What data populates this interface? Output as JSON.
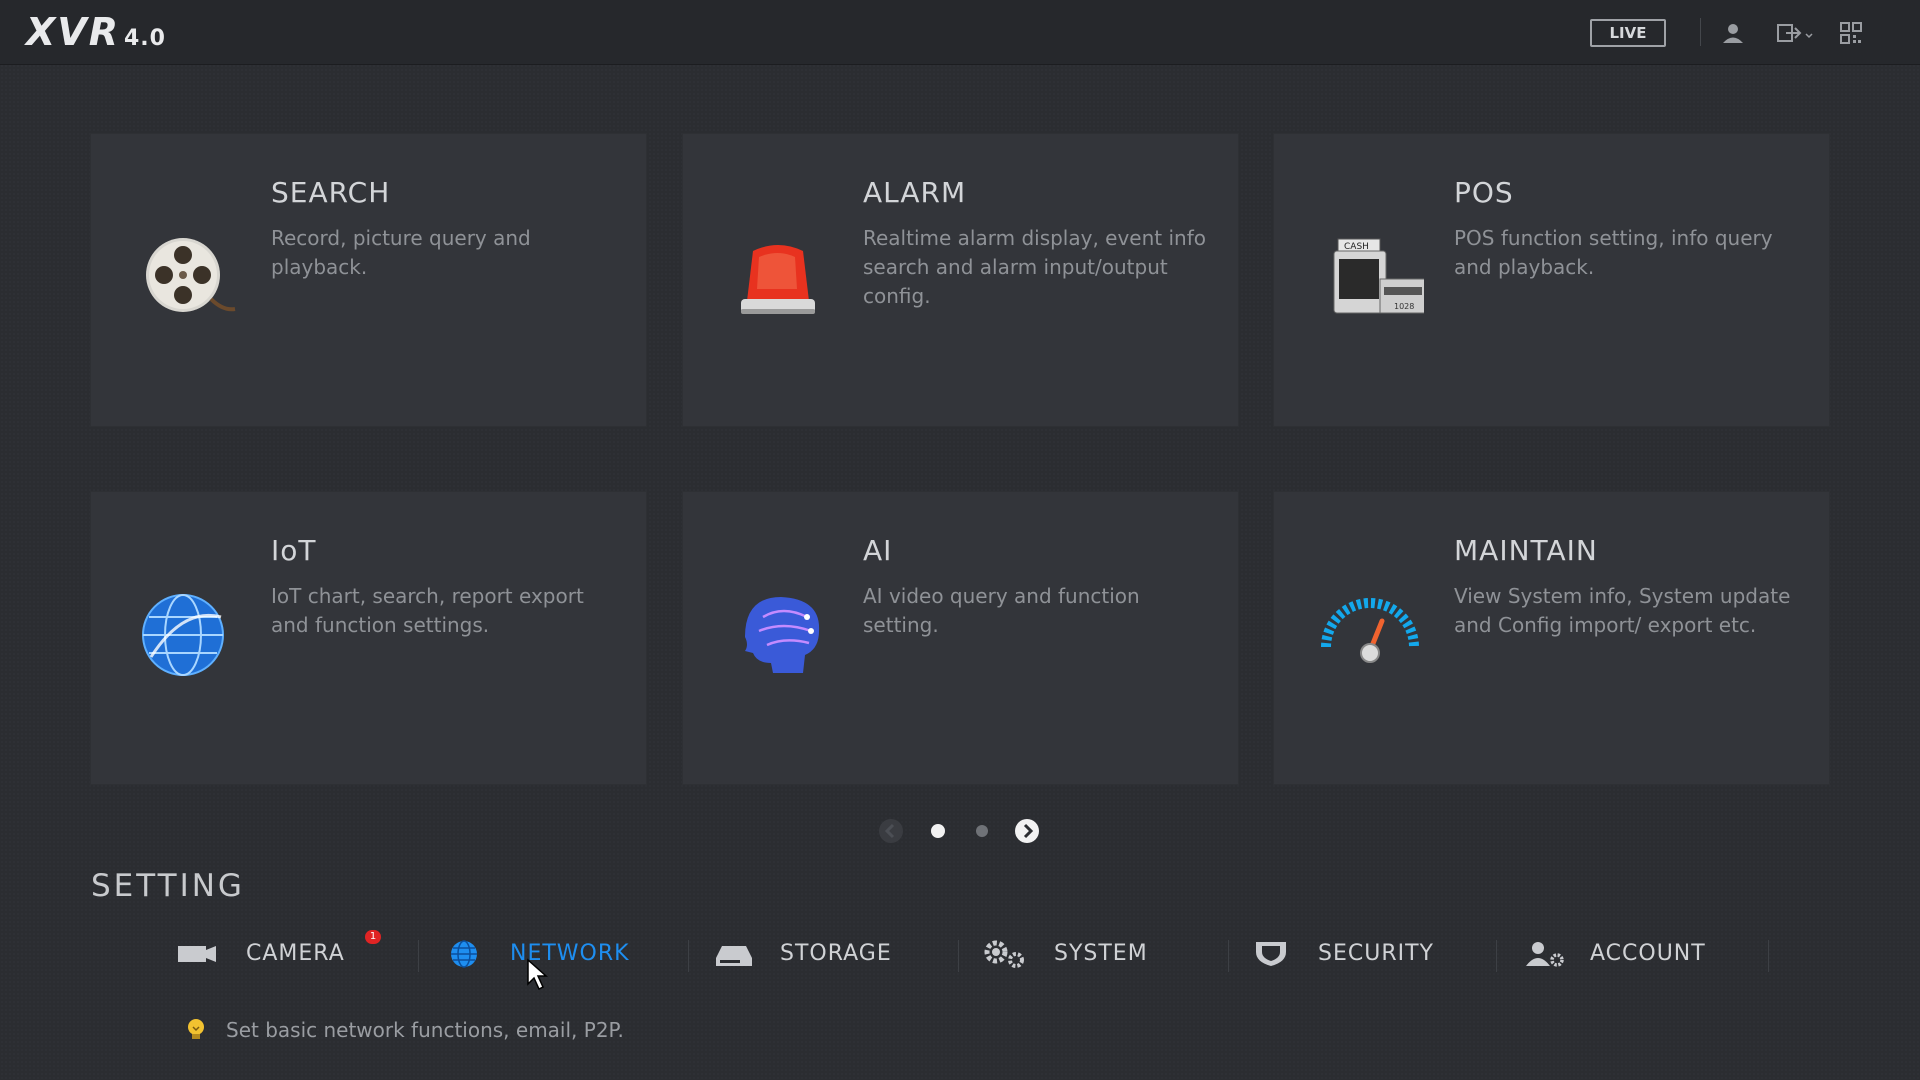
{
  "header": {
    "logo_text": "XVR",
    "logo_version": "4.0",
    "live_label": "LIVE",
    "icons": [
      "user-icon",
      "logout-icon",
      "qr-code-icon"
    ]
  },
  "cards": [
    {
      "title": "SEARCH",
      "desc": "Record, picture query and playback.",
      "icon": "film-reel-icon"
    },
    {
      "title": "ALARM",
      "desc": "Realtime alarm display, event info search and alarm input/output config.",
      "icon": "alarm-light-icon"
    },
    {
      "title": "POS",
      "desc": "POS function setting, info query and playback.",
      "icon": "cash-register-icon"
    },
    {
      "title": "IoT",
      "desc": "IoT chart, search, report export and function settings.",
      "icon": "globe-icon"
    },
    {
      "title": "AI",
      "desc": "AI video query and function setting.",
      "icon": "ai-head-icon"
    },
    {
      "title": "MAINTAIN",
      "desc": "View System info, System update and Config import/ export etc.",
      "icon": "gauge-icon"
    }
  ],
  "pager": {
    "pages": 2,
    "current": 1
  },
  "setting": {
    "title": "SETTING",
    "items": [
      {
        "label": "CAMERA",
        "icon": "camera-icon",
        "badge": "1"
      },
      {
        "label": "NETWORK",
        "icon": "network-globe-icon",
        "active": true
      },
      {
        "label": "STORAGE",
        "icon": "hdd-icon"
      },
      {
        "label": "SYSTEM",
        "icon": "gears-icon"
      },
      {
        "label": "SECURITY",
        "icon": "shield-icon"
      },
      {
        "label": "ACCOUNT",
        "icon": "account-icon"
      }
    ],
    "hint": "Set basic network functions, email, P2P."
  },
  "colors": {
    "accent": "#1e8ef0",
    "background": "#2b2d31",
    "card": "#33353a"
  }
}
